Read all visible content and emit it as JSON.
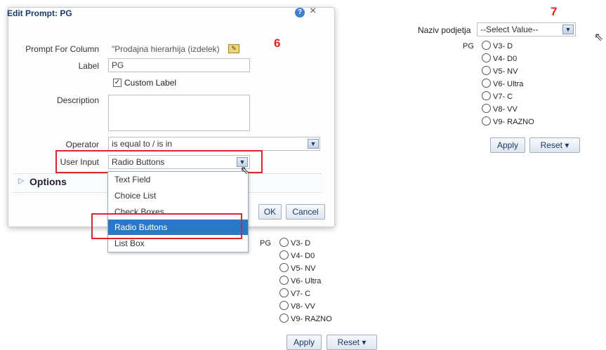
{
  "dialog": {
    "title": "Edit Prompt: PG",
    "help_icon": "?",
    "close_icon": "×",
    "prompt_for_column_label": "Prompt For Column",
    "prompt_for_column_value": "\"Prodajna hierarhija (izdelek)",
    "label_label": "Label",
    "label_value": "PG",
    "custom_label": "Custom Label",
    "custom_label_checked": true,
    "description_label": "Description",
    "description_value": "",
    "operator_label": "Operator",
    "operator_value": "is equal to / is in",
    "user_input_label": "User Input",
    "user_input_value": "Radio Buttons",
    "options_label": "Options",
    "ok_label": "OK",
    "cancel_label": "Cancel",
    "step_marker": "6",
    "user_input_options": [
      "Text Field",
      "Choice List",
      "Check Boxes",
      "Radio Buttons",
      "List Box"
    ],
    "selected_option": "Radio Buttons"
  },
  "preview_bottom": {
    "label": "PG",
    "options": [
      "V3- D",
      "V4- D0",
      "V5- NV",
      "V6- Ultra",
      "V7- C",
      "V8- VV",
      "V9- RAZNO"
    ],
    "apply_label": "Apply",
    "reset_label": "Reset"
  },
  "preview_right": {
    "step_marker": "7",
    "select_label": "Naziv podjetja",
    "select_value": "--Select Value--",
    "label": "PG",
    "options": [
      "V3- D",
      "V4- D0",
      "V5- NV",
      "V6- Ultra",
      "V7- C",
      "V8- VV",
      "V9- RAZNO"
    ],
    "apply_label": "Apply",
    "reset_label": "Reset"
  },
  "colors": {
    "highlight_red": "#d9262c",
    "selected_blue": "#2b77c7",
    "title_blue": "#1b3a66"
  },
  "icons": {
    "help": "help-icon",
    "close": "close-icon",
    "edit": "edit-icon",
    "dropdown": "chevron-down-icon",
    "expand": "expand-triangle-icon",
    "cursor": "mouse-cursor-icon"
  }
}
